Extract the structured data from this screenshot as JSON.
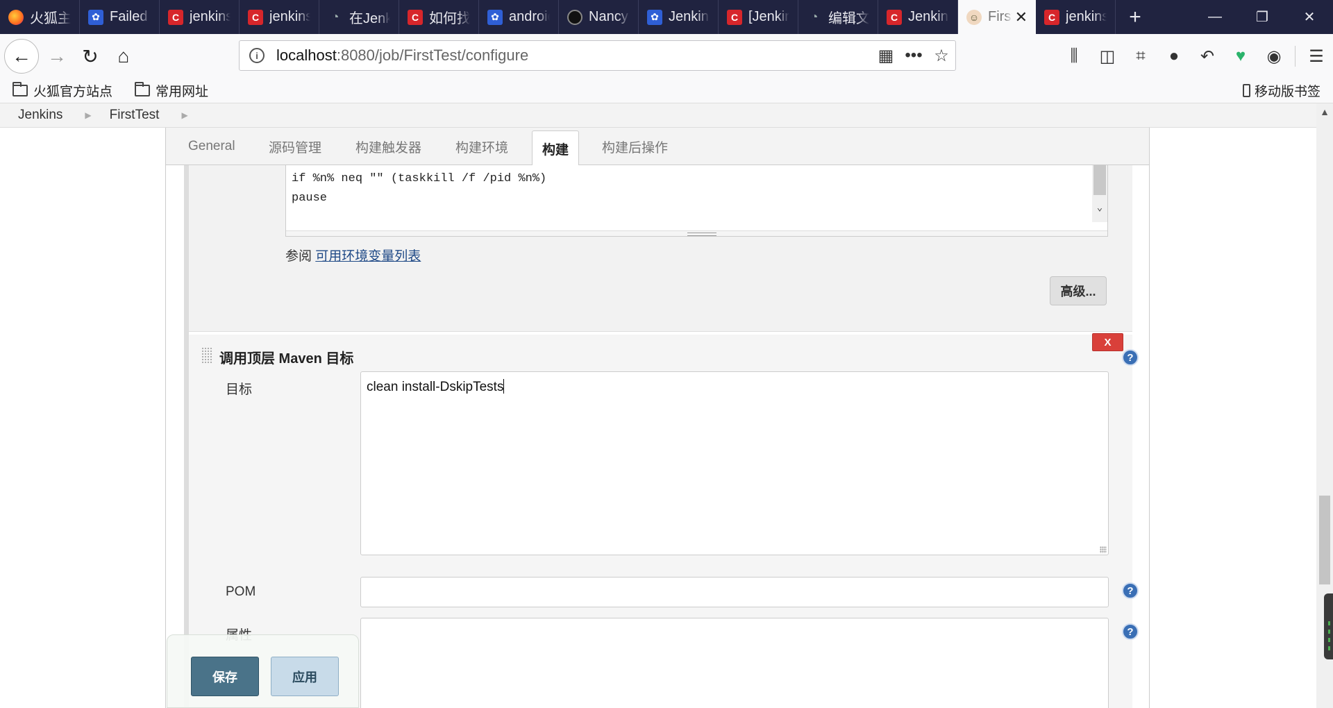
{
  "browser": {
    "tabs": [
      {
        "title": "火狐主页",
        "icon": "firefox-icon"
      },
      {
        "title": "Failed",
        "icon": "baidu-paw-icon"
      },
      {
        "title": "jenkins",
        "icon": "csdn-icon"
      },
      {
        "title": "jenkins",
        "icon": "csdn-icon"
      },
      {
        "title": "在Jenkins",
        "icon": "generic-page-icon"
      },
      {
        "title": "如何找",
        "icon": "csdn-icon"
      },
      {
        "title": "android",
        "icon": "baidu-paw-icon"
      },
      {
        "title": "Nancy",
        "icon": "github-icon"
      },
      {
        "title": "Jenkins",
        "icon": "baidu-paw-icon"
      },
      {
        "title": "[Jenkins",
        "icon": "csdn-icon"
      },
      {
        "title": "编辑文",
        "icon": "generic-page-icon"
      },
      {
        "title": "Jenkins",
        "icon": "csdn-icon"
      },
      {
        "title": "FirstTest",
        "icon": "jenkins-butler-icon",
        "active": true
      },
      {
        "title": "jenkins",
        "icon": "csdn-icon"
      }
    ],
    "url_host": "localhost",
    "url_rest": ":8080/job/FirstTest/configure",
    "bookmarks": [
      "火狐官方站点",
      "常用网址"
    ],
    "mobile_bookmarks": "移动版书签"
  },
  "jenkins": {
    "breadcrumbs": [
      "Jenkins",
      "FirstTest"
    ],
    "config_tabs": [
      "General",
      "源码管理",
      "构建触发器",
      "构建环境",
      "构建",
      "构建后操作"
    ],
    "active_tab": "构建",
    "script_lines": [
      "if %n% neq \"\" (taskkill /f /pid %n%)",
      "pause"
    ],
    "see_also_prefix": "参阅",
    "see_also_link": "可用环境变量列表",
    "advanced_button": "高级...",
    "maven_step": {
      "title": "调用顶层 Maven 目标",
      "delete_label": "X",
      "goals_label": "目标",
      "goals_value": "clean install-DskipTests",
      "pom_label": "POM",
      "pom_value": "",
      "props_label": "属性",
      "props_value": ""
    },
    "save_button": "保存",
    "apply_button": "应用"
  },
  "colors": {
    "tabstrip_bg": "#202340",
    "save_bg": "#4a7389",
    "apply_bg": "#c8dbe9",
    "delete_bg": "#d9403a",
    "help_bg": "#3a6fb5",
    "link": "#204a87"
  }
}
